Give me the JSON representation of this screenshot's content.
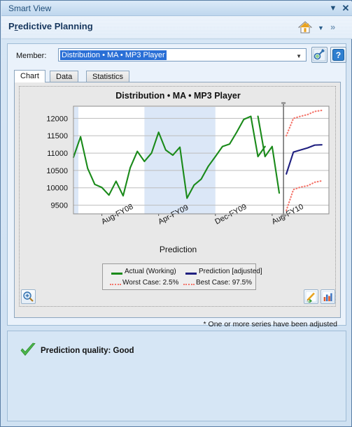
{
  "window": {
    "title": "Smart View",
    "dropdown_icon": "chevron-down-icon",
    "close_icon": "close-icon"
  },
  "header": {
    "title_prefix": "P",
    "title_underlined": "r",
    "title_suffix": "edictive Planning",
    "title_full": "Predictive Planning",
    "home_icon": "home-icon",
    "dropdown_icon": "chevron-down-icon",
    "more_icon": "chevron-double-right-icon"
  },
  "member": {
    "label": "Member:",
    "value": "Distribution • MA • MP3 Player",
    "placeholder": "",
    "caret_icon": "chevron-down-icon",
    "pin_button_icon": "pin-connect-icon",
    "help_button_icon": "help-question-icon"
  },
  "tabs": [
    {
      "label": "Chart",
      "active": true
    },
    {
      "label": "Data",
      "active": false
    },
    {
      "label": "Statistics",
      "active": false
    }
  ],
  "chart_toolbar": {
    "zoom_icon": "zoom-in-icon",
    "edit_icon": "edit-pencil-icon",
    "chart_icon": "bar-chart-icon"
  },
  "footnote": "* One or more series have been adjusted",
  "quality": {
    "icon": "green-check-icon",
    "text": "Prediction quality: Good"
  },
  "colors": {
    "actual": "#1a8a1a",
    "prediction": "#202080",
    "case_bands": "#f4756b",
    "band_shade": "#dbe7f7",
    "titlebar": "#cbdff2",
    "panel": "#eaf2fb",
    "selection": "#2a6fd6"
  },
  "chart_data": {
    "type": "line",
    "title": "Distribution • MA • MP3 Player",
    "xlabel": "Prediction",
    "ylabel": "",
    "ylim": [
      9250,
      12350
    ],
    "yticks": [
      9500,
      10000,
      10500,
      11000,
      11500,
      12000
    ],
    "xtick_labels": [
      "Aug-FY08",
      "Apr-FY09",
      "Dec-FY09",
      "Aug-FY10"
    ],
    "xtick_positions": [
      4,
      12,
      20,
      28
    ],
    "grid": true,
    "legend_position": "bottom-center",
    "history_forecast_split_index": 27,
    "shaded_band_range": [
      10,
      20
    ],
    "legend": [
      {
        "name": "Actual (Working)",
        "color": "#1a8a1a",
        "style": "solid"
      },
      {
        "name": "Prediction [adjusted]",
        "color": "#202080",
        "style": "solid"
      },
      {
        "name": "Worst Case: 2.5%",
        "color": "#f4756b",
        "style": "dotted"
      },
      {
        "name": "Best Case: 97.5%",
        "color": "#f4756b",
        "style": "dotted"
      }
    ],
    "series": [
      {
        "name": "Actual (Working)",
        "color": "#1a8a1a",
        "style": "solid",
        "x": [
          0,
          1,
          2,
          3,
          4,
          5,
          6,
          7,
          8,
          9,
          10,
          11,
          12,
          13,
          14,
          15,
          16,
          17,
          18,
          19,
          20,
          21,
          22,
          23,
          24,
          25,
          26,
          27
        ],
        "values": [
          10880,
          11470,
          10560,
          10100,
          10010,
          9790,
          10190,
          9770,
          10580,
          11050,
          10760,
          11000,
          11600,
          11090,
          10940,
          11170,
          9700,
          10080,
          10250,
          10620,
          10900,
          11190,
          11260,
          11600,
          11970,
          12060,
          10900,
          11190
        ]
      },
      {
        "name": "Actual (Working) tail",
        "color": "#1a8a1a",
        "style": "solid",
        "x": [
          26,
          27,
          28,
          29
        ],
        "values": [
          12060,
          10900,
          11190,
          9850
        ]
      },
      {
        "name": "Prediction [adjusted]",
        "color": "#202080",
        "style": "solid",
        "x": [
          30,
          31,
          32,
          33,
          34,
          35
        ],
        "values": [
          10400,
          11030,
          11090,
          11150,
          11230,
          11240
        ]
      },
      {
        "name": "Worst Case: 2.5%",
        "color": "#f4756b",
        "style": "dotted",
        "x": [
          30,
          31,
          32,
          33,
          34,
          35
        ],
        "values": [
          9350,
          9950,
          10020,
          10060,
          10160,
          10200
        ]
      },
      {
        "name": "Best Case: 97.5%",
        "color": "#f4756b",
        "style": "dotted",
        "x": [
          30,
          31,
          32,
          33,
          34,
          35
        ],
        "values": [
          11500,
          12000,
          12060,
          12110,
          12200,
          12230
        ]
      }
    ]
  }
}
